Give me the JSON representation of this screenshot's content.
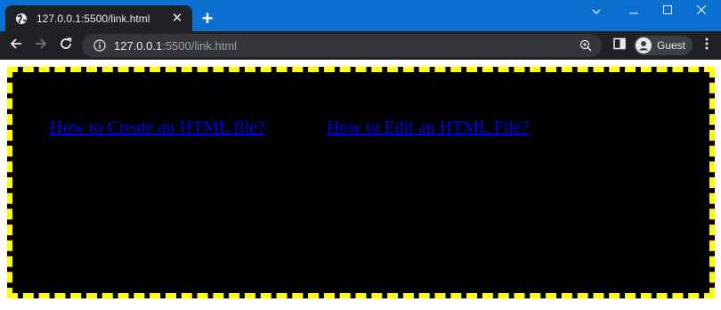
{
  "browser": {
    "tab": {
      "title": "127.0.0.1:5500/link.html",
      "favicon": "globe-icon",
      "close_label": "✕"
    },
    "new_tab_label": "+",
    "window_controls": [
      "chevron-down-icon",
      "minimize-icon",
      "maximize-icon",
      "close-icon"
    ],
    "toolbar": {
      "url_host": "127.0.0.1",
      "url_path": ":5500/link.html",
      "profile_label": "Guest"
    },
    "colors": {
      "tabstrip": "#0b6fd0",
      "toolbar": "#202124",
      "omnibox": "#35363a"
    }
  },
  "page": {
    "links": [
      {
        "label": "How to Create an HTML file?"
      },
      {
        "label": "How to Edit an HTML File?"
      }
    ],
    "colors": {
      "box_background": "#000000",
      "box_border": "#ffff00",
      "link": "#0000ee"
    }
  }
}
